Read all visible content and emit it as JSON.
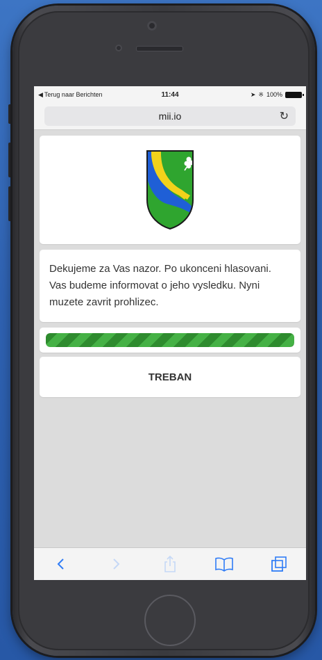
{
  "status_bar": {
    "back_label": "Terug naar Berichten",
    "time": "11:44",
    "battery": "100%"
  },
  "browser": {
    "url": "mii.io",
    "reload_icon": "reload-icon"
  },
  "crest": {
    "icon": "municipal-coat-of-arms",
    "colors": {
      "green": "#2fa52f",
      "yellow": "#f2d21b",
      "blue": "#1f5fd6",
      "outline": "#1a1a1a"
    }
  },
  "message": {
    "text": "Dekujeme za Vas nazor. Po ukonceni hlasovani. Vas budeme informovat o jeho vysledku. Nyni muzete zavrit prohlizec."
  },
  "progress": {
    "value": 1.0,
    "color": "#3aa23a"
  },
  "town": {
    "name": "TREBAN"
  },
  "toolbar": {
    "items": [
      "back-icon",
      "forward-icon",
      "share-icon",
      "bookmarks-icon",
      "tabs-icon"
    ],
    "accent": "#2f7cf6",
    "disabled": "#c5d8f6"
  }
}
